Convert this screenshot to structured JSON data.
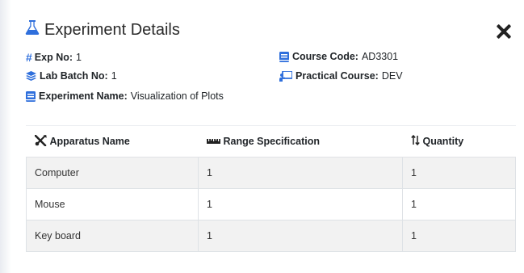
{
  "modal": {
    "title": "Experiment Details"
  },
  "details": {
    "exp_no_label": "Exp No:",
    "exp_no_value": "1",
    "lab_batch_label": "Lab Batch No:",
    "lab_batch_value": "1",
    "experiment_name_label": "Experiment Name:",
    "experiment_name_value": "Visualization of Plots",
    "course_code_label": "Course Code:",
    "course_code_value": "AD3301",
    "practical_course_label": "Practical Course:",
    "practical_course_value": "DEV"
  },
  "table": {
    "headers": [
      "Apparatus Name",
      "Range Specification",
      "Quantity"
    ],
    "rows": [
      [
        "Computer",
        "1",
        "1"
      ],
      [
        "Mouse",
        "1",
        "1"
      ],
      [
        "Key board",
        "1",
        "1"
      ]
    ]
  },
  "colors": {
    "accent": "#2f6fdc",
    "stripe": "#f2f2f2"
  },
  "icons": [
    "flask-icon",
    "hash-icon",
    "layers-icon",
    "book-icon",
    "chalkboard-icon",
    "tools-icon",
    "ruler-icon",
    "sort-icon",
    "close-icon"
  ]
}
